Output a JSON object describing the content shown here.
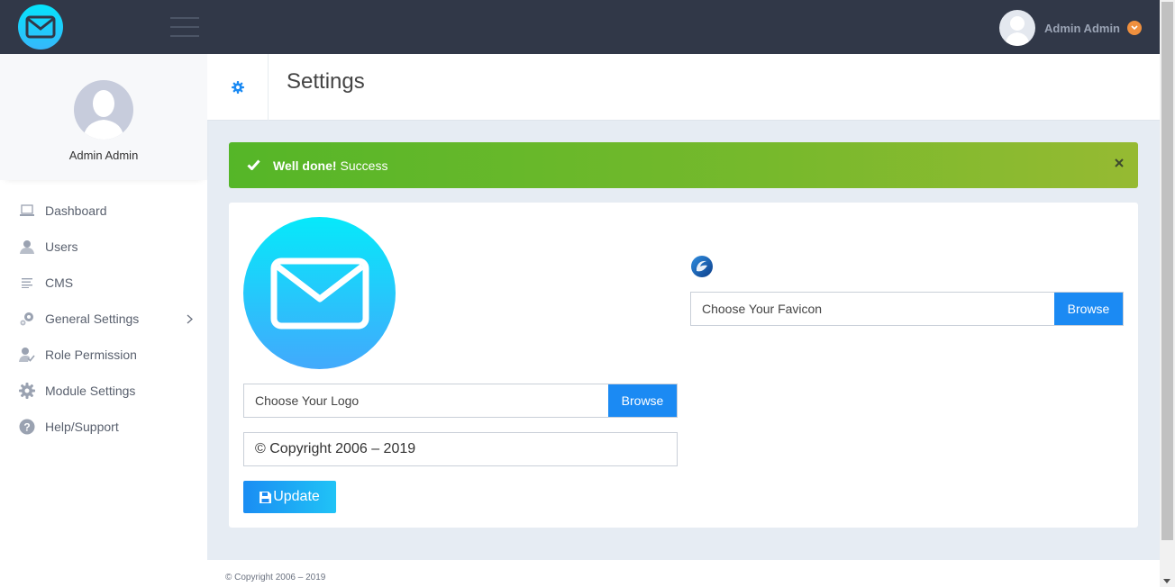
{
  "topbar": {
    "username": "Admin Admin"
  },
  "sidebar": {
    "profile_name": "Admin Admin",
    "items": [
      {
        "label": "Dashboard",
        "icon": "laptop-icon"
      },
      {
        "label": "Users",
        "icon": "user-icon"
      },
      {
        "label": "CMS",
        "icon": "list-icon"
      },
      {
        "label": "General Settings",
        "icon": "gears-icon"
      },
      {
        "label": "Role Permission",
        "icon": "user-check-icon"
      },
      {
        "label": "Module Settings",
        "icon": "gear-icon"
      },
      {
        "label": "Help/Support",
        "icon": "question-icon"
      }
    ]
  },
  "page": {
    "title": "Settings"
  },
  "alert": {
    "strong": "Well done!",
    "message": "Success"
  },
  "form": {
    "logo_placeholder": "Choose Your Logo",
    "favicon_placeholder": "Choose Your Favicon",
    "browse_label": "Browse",
    "copyright_value": "© Copyright 2006 – 2019",
    "update_label": "Update"
  },
  "footer": {
    "text": "© Copyright 2006 – 2019"
  },
  "colors": {
    "topbar": "#313848",
    "accent": "#1b8af3",
    "success": "#5ab529",
    "brand_cyan": "#06e9fa"
  }
}
